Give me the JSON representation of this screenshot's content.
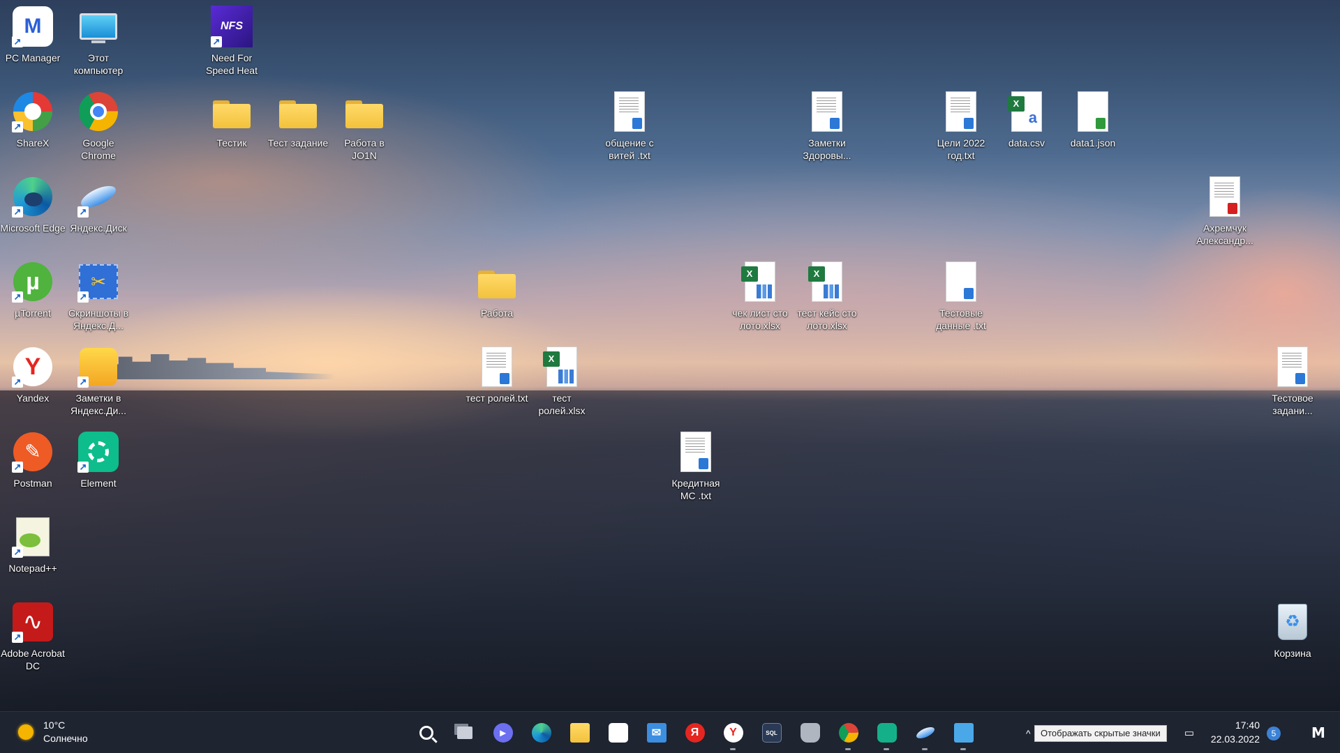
{
  "desktop": {
    "icons": [
      {
        "label": "PC Manager",
        "icon": "pc-manager-icon"
      },
      {
        "label": "Этот компьютер",
        "icon": "computer-icon"
      },
      {
        "label": "Need For Speed Heat",
        "icon": "nfs-icon",
        "badge": "NFS"
      },
      {
        "label": "ShareX",
        "icon": "sharex-icon"
      },
      {
        "label": "Google Chrome",
        "icon": "chrome-icon"
      },
      {
        "label": "Тестик",
        "icon": "folder-icon"
      },
      {
        "label": "Тест задание",
        "icon": "folder-icon"
      },
      {
        "label": "Работа в JO1N",
        "icon": "folder-icon"
      },
      {
        "label": "общение с витей .txt",
        "icon": "text-file-icon"
      },
      {
        "label": "Заметки Здоровы...",
        "icon": "text-file-icon"
      },
      {
        "label": "Цели 2022 год.txt",
        "icon": "text-file-icon"
      },
      {
        "label": "data.csv",
        "icon": "csv-file-icon"
      },
      {
        "label": "data1.json",
        "icon": "json-file-icon"
      },
      {
        "label": "Microsoft Edge",
        "icon": "edge-icon"
      },
      {
        "label": "Яндекс.Диск",
        "icon": "yandex-disk-icon"
      },
      {
        "label": "Ахремчук Александр...",
        "icon": "pdf-file-icon"
      },
      {
        "label": "µTorrent",
        "icon": "utorrent-icon"
      },
      {
        "label": "Скриншоты в Яндекс.Д...",
        "icon": "yandex-screenshots-icon"
      },
      {
        "label": "Работа",
        "icon": "folder-icon"
      },
      {
        "label": "чек лист сто лото.xlsx",
        "icon": "excel-file-icon"
      },
      {
        "label": "тест кейс сто лото.xlsx",
        "icon": "excel-file-icon"
      },
      {
        "label": "Тестовые данные .txt",
        "icon": "text-file-icon"
      },
      {
        "label": "Yandex",
        "icon": "yandex-browser-icon"
      },
      {
        "label": "Заметки в Яндекс.Ди...",
        "icon": "yandex-notes-icon"
      },
      {
        "label": "тест ролей.txt",
        "icon": "text-file-icon"
      },
      {
        "label": "тест ролей.xlsx",
        "icon": "excel-file-icon"
      },
      {
        "label": "Тестовое задани...",
        "icon": "word-file-icon"
      },
      {
        "label": "Postman",
        "icon": "postman-icon"
      },
      {
        "label": "Element",
        "icon": "element-icon"
      },
      {
        "label": "Кредитная МС .txt",
        "icon": "text-file-icon"
      },
      {
        "label": "Notepad++",
        "icon": "notepad-plus-plus-icon"
      },
      {
        "label": "Adobe Acrobat DC",
        "icon": "acrobat-icon"
      },
      {
        "label": "Корзина",
        "icon": "recycle-bin-icon"
      }
    ]
  },
  "taskbar": {
    "weather": {
      "temp": "10°C",
      "condition": "Солнечно"
    },
    "apps": [
      {
        "icon": "start-icon",
        "color": "#3aa0f0"
      },
      {
        "icon": "search-icon",
        "color": "#ffffff"
      },
      {
        "icon": "task-view-icon",
        "color": "#c9ced8"
      },
      {
        "icon": "chat-icon",
        "color": "#6b6ff0"
      },
      {
        "icon": "edge-icon",
        "color": "#1f9ad6"
      },
      {
        "icon": "file-explorer-icon",
        "color": "#f3c23c"
      },
      {
        "icon": "microsoft-store-icon",
        "color": "#2f6fd6"
      },
      {
        "icon": "mail-icon",
        "color": "#3b8ee0"
      },
      {
        "icon": "yandex-icon",
        "color": "#e52620",
        "glyph": "Я"
      },
      {
        "icon": "yandex-browser-icon",
        "color": "#e52620"
      },
      {
        "icon": "mysql-workbench-icon",
        "color": "#2a3a55"
      },
      {
        "icon": "postman-jug-icon",
        "color": "#b0b6c0"
      },
      {
        "icon": "chrome-icon",
        "color": "#e8453c"
      },
      {
        "icon": "element-icon",
        "color": "#14b08a"
      },
      {
        "icon": "yandex-disk-icon",
        "color": "#3a8fe8"
      },
      {
        "icon": "notepad-icon",
        "color": "#4aa8e8"
      }
    ],
    "tray": {
      "tooltip": "Отображать скрытые значки",
      "time": "17:40",
      "date": "22.03.2022",
      "notifications": "5"
    }
  }
}
